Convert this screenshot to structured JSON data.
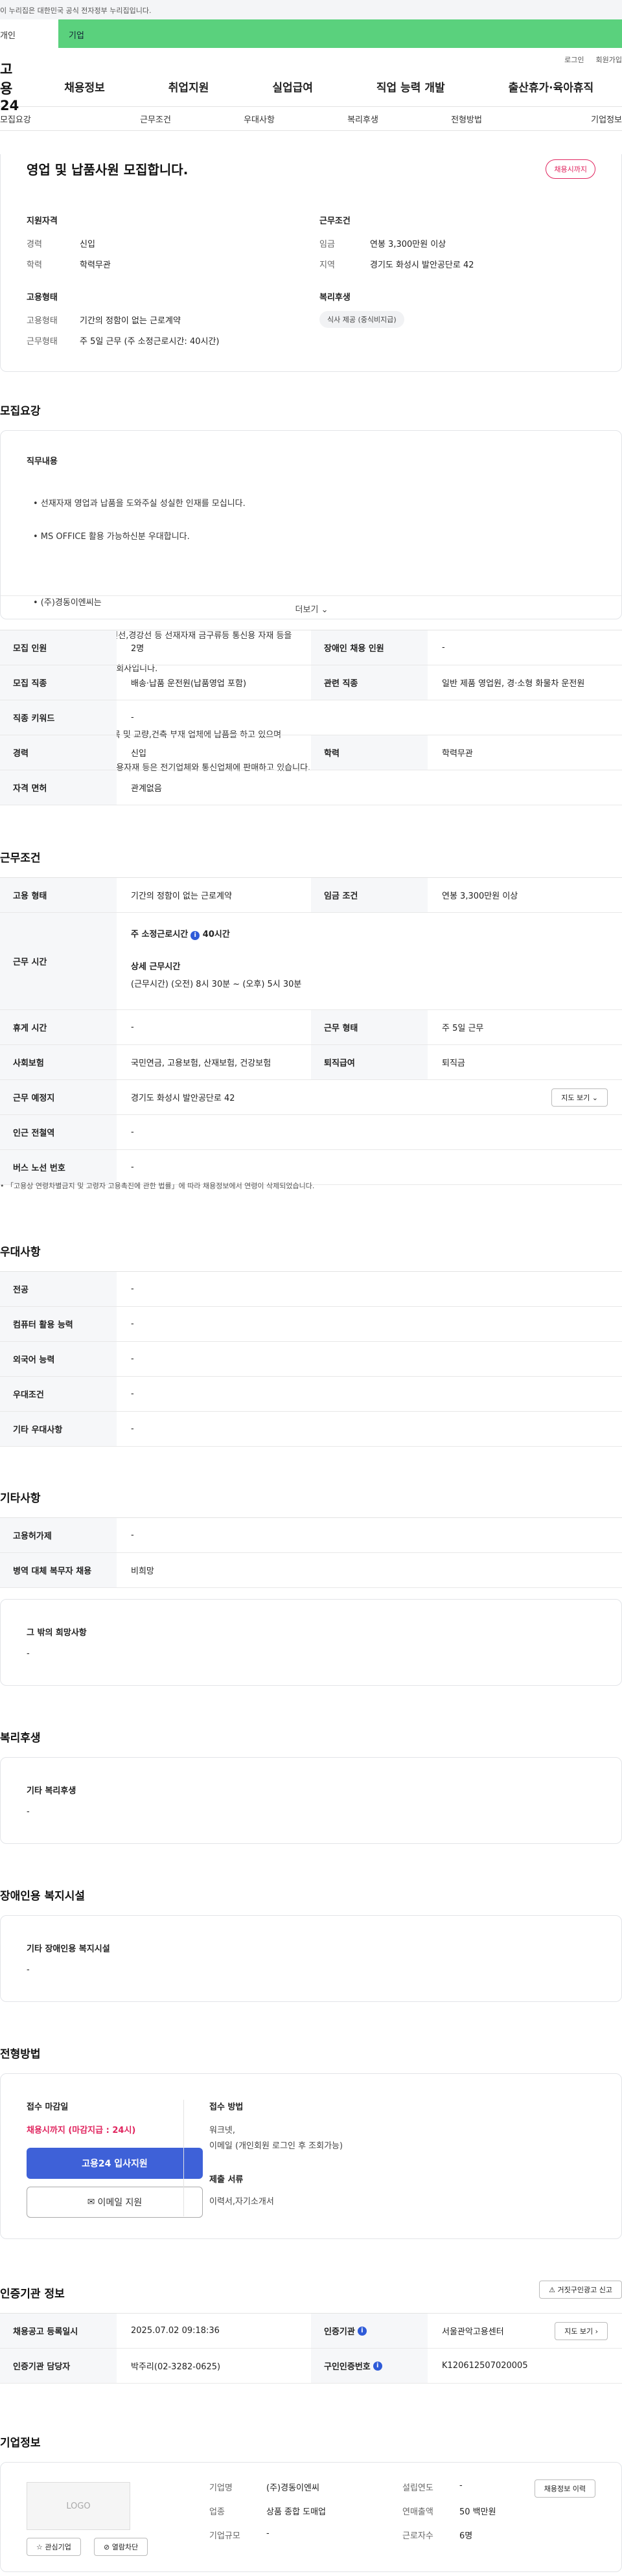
{
  "gov_banner": "이 누리집은 대한민국 공식 전자정부 누리집입니다.",
  "top_tabs": [
    "개인",
    "기업"
  ],
  "util": [
    "로그인",
    "회원가입"
  ],
  "logo": "고용24",
  "gnb": [
    "채용정보",
    "취업지원",
    "실업급여",
    "직업 능력 개발",
    "출산휴가·육아휴직"
  ],
  "snb": [
    "모집요강",
    "근무조건",
    "우대사항",
    "복리후생",
    "전형방법",
    "기업정보"
  ],
  "summary": {
    "title": "영업 및 납품사원 모집합니다.",
    "deadline_badge": "채용시까지",
    "qual_h": "지원자격",
    "exp_k": "경력",
    "exp_v": "신입",
    "edu_k": "학력",
    "edu_v": "학력무관",
    "cond_h": "근무조건",
    "wage_k": "임금",
    "wage_v": "연봉 3,300만원 이상",
    "area_k": "지역",
    "area_v": "경기도 화성시 발안공단로 42",
    "emp_h": "고용형태",
    "etype_k": "고용형태",
    "etype_v": "기간의 정함이 없는 근로계약",
    "wform_k": "근무형태",
    "wform_v": "주 5일 근무 (주 소정근로시간: 40시간)",
    "welf_h": "복리후생",
    "welf_tag": "식사 제공 (중식비지급)"
  },
  "recruit": {
    "h": "모집요강",
    "duty_h": "직무내용",
    "duty_lines": [
      "• 선재자재 영업과 납품을 도와주실 성실한 인재를 모십니다.",
      "• MS OFFICE 활용 가능하신분 우대합니다.",
      "",
      "• (주)경동이엔씨는",
      "   P.C강연선,아연도강연선,경강선 등 선재자재 금구류등 통신용 자재 등을",
      "   전문적으로 유통하는 회사입니다.",
      "",
      "• P.C강연선은 철도 침목 및 교량,건축 부재 업체에 납품을 하고 있으며",
      "   아연도강연선 및 통신용자재 등은 전기업체와 통신업체에 판매하고 있습니다."
    ],
    "more": "더보기",
    "rows": [
      [
        "모집 인원",
        "2명",
        "장애인 채용 인원",
        "-"
      ],
      [
        "모집 직종",
        "배송·납품 운전원(납품영업 포함)",
        "관련 직종",
        "일반 제품 영업원, 경·소형 화물차 운전원"
      ],
      [
        "직종 키워드",
        "-"
      ],
      [
        "경력",
        "신입",
        "학력",
        "학력무관"
      ],
      [
        "자격 면허",
        "관계없음"
      ]
    ]
  },
  "work": {
    "h": "근무조건",
    "etype_k": "고용 형태",
    "etype_v": "기간의 정함이 없는 근로계약",
    "wage_k": "임금 조건",
    "wage_v": "연봉 3,300만원 이상",
    "time_k": "근무 시간",
    "time_l1": "주 소정근로시간",
    "time_l1b": "40시간",
    "time_l2": "상세 근무시간",
    "time_l3": "(근무시간) (오전) 8시 30분 ~ (오후) 5시 30분",
    "rest_k": "휴게 시간",
    "rest_v": "-",
    "wtype_k": "근무 형태",
    "wtype_v": "주 5일 근무",
    "ins_k": "사회보험",
    "ins_v": "국민연금, 고용보험, 산재보험, 건강보험",
    "sev_k": "퇴직급여",
    "sev_v": "퇴직금",
    "place_k": "근무 예정지",
    "place_v": "경기도 화성시 발안공단로 42",
    "map_btn": "지도 보기",
    "sub_k": "인근 전철역",
    "sub_v": "-",
    "bus_k": "버스 노선 번호",
    "bus_v": "-",
    "note": "「고용상 연령차별금지 및 고령자 고용촉진에 관한 법률」에 따라 채용정보에서 연령이 삭제되었습니다."
  },
  "prefer": {
    "h": "우대사항",
    "rows": [
      [
        "전공",
        "-"
      ],
      [
        "컴퓨터 활용 능력",
        "-"
      ],
      [
        "외국어 능력",
        "-"
      ],
      [
        "우대조건",
        "-"
      ],
      [
        "기타 우대사항",
        "-"
      ]
    ]
  },
  "etc": {
    "h": "기타사항",
    "rows": [
      [
        "고용허가제",
        "-"
      ],
      [
        "병역 대체 복무자 채용",
        "비희망"
      ]
    ],
    "box_h": "그 밖의 희망사항",
    "box_v": "-"
  },
  "welfare": {
    "h": "복리후생",
    "box_h": "기타 복리후생",
    "box_v": "-"
  },
  "disabled": {
    "h": "장애인용 복지시설",
    "box_h": "기타 장애인용 복지시설",
    "box_v": "-"
  },
  "process": {
    "h": "전형방법",
    "recv_h": "접수 마감일",
    "recv_v": "채용시까지 (마감지급 : 24시)",
    "apply_btn": "고용24 입사지원",
    "email_btn": "이메일 지원",
    "method_h": "접수 방법",
    "method_v1": "워크넷,",
    "method_v2": "이메일 (개인회원 로그인 후 조회가능)",
    "doc_h": "제출 서류",
    "doc_v": "이력서,자기소개서"
  },
  "agency": {
    "h": "인증기관 정보",
    "report_btn": "거짓구인광고 신고",
    "rows": [
      [
        "채용공고 등록일시",
        "2025.07.02 09:18:36",
        "인증기관",
        "서울관악고용센터"
      ],
      [
        "인증기관 담당자",
        "박주리(02-3282-0625)",
        "구인인증번호",
        "K120612507020005"
      ]
    ],
    "map_btn": "지도 보기"
  },
  "company": {
    "h": "기업정보",
    "logo": "LOGO",
    "fav_btn": "관심기업",
    "block_btn": "열람차단",
    "hist_btn": "채용정보 이력",
    "name_k": "기업명",
    "name_v": "(주)경동이엔씨",
    "year_k": "설립연도",
    "year_v": "-",
    "ind_k": "업종",
    "ind_v": "상품 종합 도매업",
    "sales_k": "연매출액",
    "sales_v": "50 백만원",
    "size_k": "기업규모",
    "size_v": "-",
    "staff_k": "근로자수",
    "staff_v": "6명"
  },
  "colors": {
    "green": "#5ad17d",
    "blue": "#3e61d8",
    "pink": "#e0245e"
  }
}
